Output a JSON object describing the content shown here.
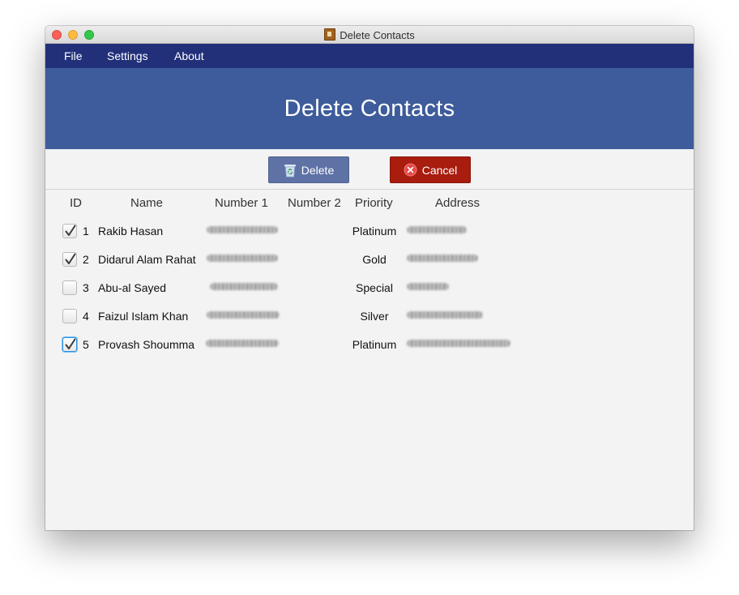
{
  "window": {
    "title": "Delete Contacts"
  },
  "menu": {
    "file": "File",
    "settings": "Settings",
    "about": "About"
  },
  "header": {
    "title": "Delete Contacts"
  },
  "toolbar": {
    "delete_label": "Delete",
    "cancel_label": "Cancel"
  },
  "table": {
    "columns": {
      "id": "ID",
      "name": "Name",
      "number1": "Number 1",
      "number2": "Number 2",
      "priority": "Priority",
      "address": "Address"
    },
    "rows": [
      {
        "id": "1",
        "name": "Rakib Hasan",
        "priority": "Platinum",
        "checked": true
      },
      {
        "id": "2",
        "name": "Didarul Alam Rahat",
        "priority": "Gold",
        "checked": true
      },
      {
        "id": "3",
        "name": "Abu-al Sayed",
        "priority": "Special",
        "checked": false
      },
      {
        "id": "4",
        "name": "Faizul Islam Khan",
        "priority": "Silver",
        "checked": false
      },
      {
        "id": "5",
        "name": "Provash Shoumma",
        "priority": "Platinum",
        "checked": true
      }
    ]
  },
  "colors": {
    "menubar": "#22307a",
    "header": "#3e5c9b",
    "delete_button": "#5e72a6",
    "cancel_button": "#a81d0e"
  },
  "icons": {
    "delete": "recycle-bin-icon",
    "cancel": "close-circle-icon",
    "app": "app-icon"
  }
}
